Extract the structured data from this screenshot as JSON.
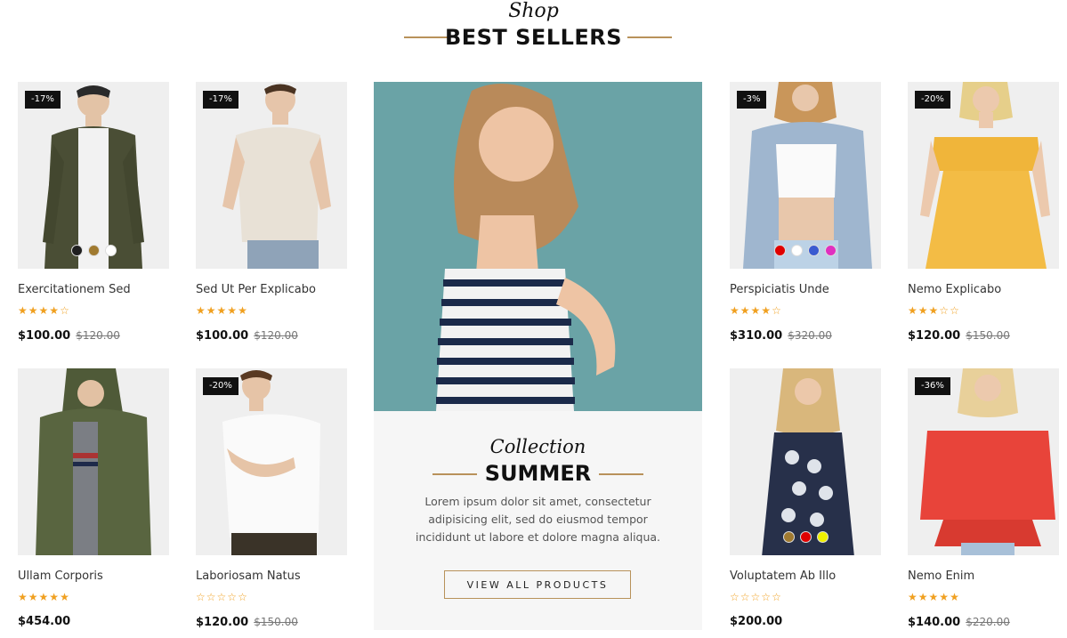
{
  "header": {
    "script": "Shop",
    "title": "BEST SELLERS"
  },
  "promo": {
    "script": "Collection",
    "title": "SUMMER",
    "text": "Lorem ipsum dolor sit amet, consectetur adipisicing elit, sed do eiusmod tempor incididunt ut labore et dolore magna aliqua.",
    "button": "VIEW ALL PRODUCTS"
  },
  "products": [
    {
      "name": "Exercitationem Sed",
      "badge": "-17%",
      "rating": 4,
      "price": "$100.00",
      "old_price": "$120.00",
      "swatches": [
        "#1f1f1f",
        "#a07a30",
        "#ffffff"
      ]
    },
    {
      "name": "Sed Ut Per Explicabo",
      "badge": "-17%",
      "rating": 5,
      "price": "$100.00",
      "old_price": "$120.00",
      "swatches": []
    },
    {
      "name": "Perspiciatis Unde",
      "badge": "-3%",
      "rating": 4,
      "price": "$310.00",
      "old_price": "$320.00",
      "swatches": [
        "#e00000",
        "#ffffff",
        "#3a5bd0",
        "#e030c0"
      ]
    },
    {
      "name": "Nemo Explicabo",
      "badge": "-20%",
      "rating": 3,
      "price": "$120.00",
      "old_price": "$150.00",
      "swatches": []
    },
    {
      "name": "Ullam Corporis",
      "badge": "",
      "rating": 5,
      "price": "$454.00",
      "old_price": "",
      "swatches": []
    },
    {
      "name": "Laboriosam Natus",
      "badge": "-20%",
      "rating": 0,
      "price": "$120.00",
      "old_price": "$150.00",
      "swatches": []
    },
    {
      "name": "Voluptatem Ab Illo",
      "badge": "",
      "rating": 0,
      "price": "$200.00",
      "old_price": "",
      "swatches": [
        "#a07a30",
        "#e00000",
        "#f0f000"
      ]
    },
    {
      "name": "Nemo Enim",
      "badge": "-36%",
      "rating": 5,
      "price": "$140.00",
      "old_price": "$220.00",
      "swatches": []
    }
  ],
  "colors": {
    "accent": "#b8925a",
    "star": "#f0a020",
    "badge_bg": "#111111"
  }
}
